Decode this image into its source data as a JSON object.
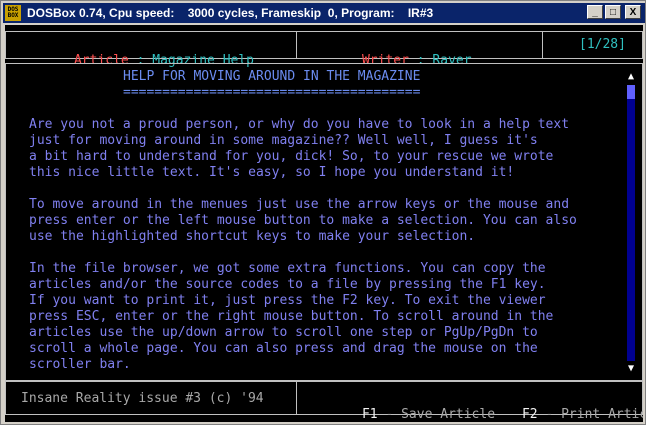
{
  "window": {
    "icon_label": "DOS BOX",
    "title": "DOSBox 0.74, Cpu speed:    3000 cycles, Frameskip  0, Program:    IR#3",
    "buttons": {
      "minimize": "_",
      "maximize": "□",
      "close": "X"
    }
  },
  "header": {
    "article_label": "Article",
    "article_sep": " : ",
    "article_value": "Magazine Help",
    "writer_label": "Writer",
    "writer_sep": " : ",
    "writer_value": "Raver",
    "page_indicator": "[1/28]"
  },
  "article": {
    "heading": "HELP FOR MOVING AROUND IN THE MAGAZINE",
    "underline": "======================================",
    "lines": [
      "Are you not a proud person, or why do you have to look in a help text",
      "just for moving around in some magazine?? Well well, I guess it's",
      "a bit hard to understand for you, dick! So, to your rescue we wrote",
      "this nice little text. It's easy, so I hope you understand it!",
      "",
      "To move around in the menues just use the arrow keys or the mouse and",
      "press enter or the left mouse button to make a selection. You can also",
      "use the highlighted shortcut keys to make your selection.",
      "",
      "In the file browser, we got some extra functions. You can copy the",
      "articles and/or the source codes to a file by pressing the F1 key.",
      "If you want to print it, just press the F2 key. To exit the viewer",
      "press ESC, enter or the right mouse button. To scroll around in the",
      "articles use the up/down arrow to scroll one step or PgUp/PgDn to",
      "scroll a whole page. You can also press and drag the mouse on the",
      "scroller bar."
    ]
  },
  "scrollbar": {
    "up_arrow": "▲",
    "down_arrow": "▼",
    "position_fraction": 0.0
  },
  "footer": {
    "issue_text": "Insane Reality issue #3 (c) '94",
    "f1_key": "F1",
    "f1_label": " - Save Article",
    "f2_key": "F2",
    "f2_label": " - Print Article"
  }
}
